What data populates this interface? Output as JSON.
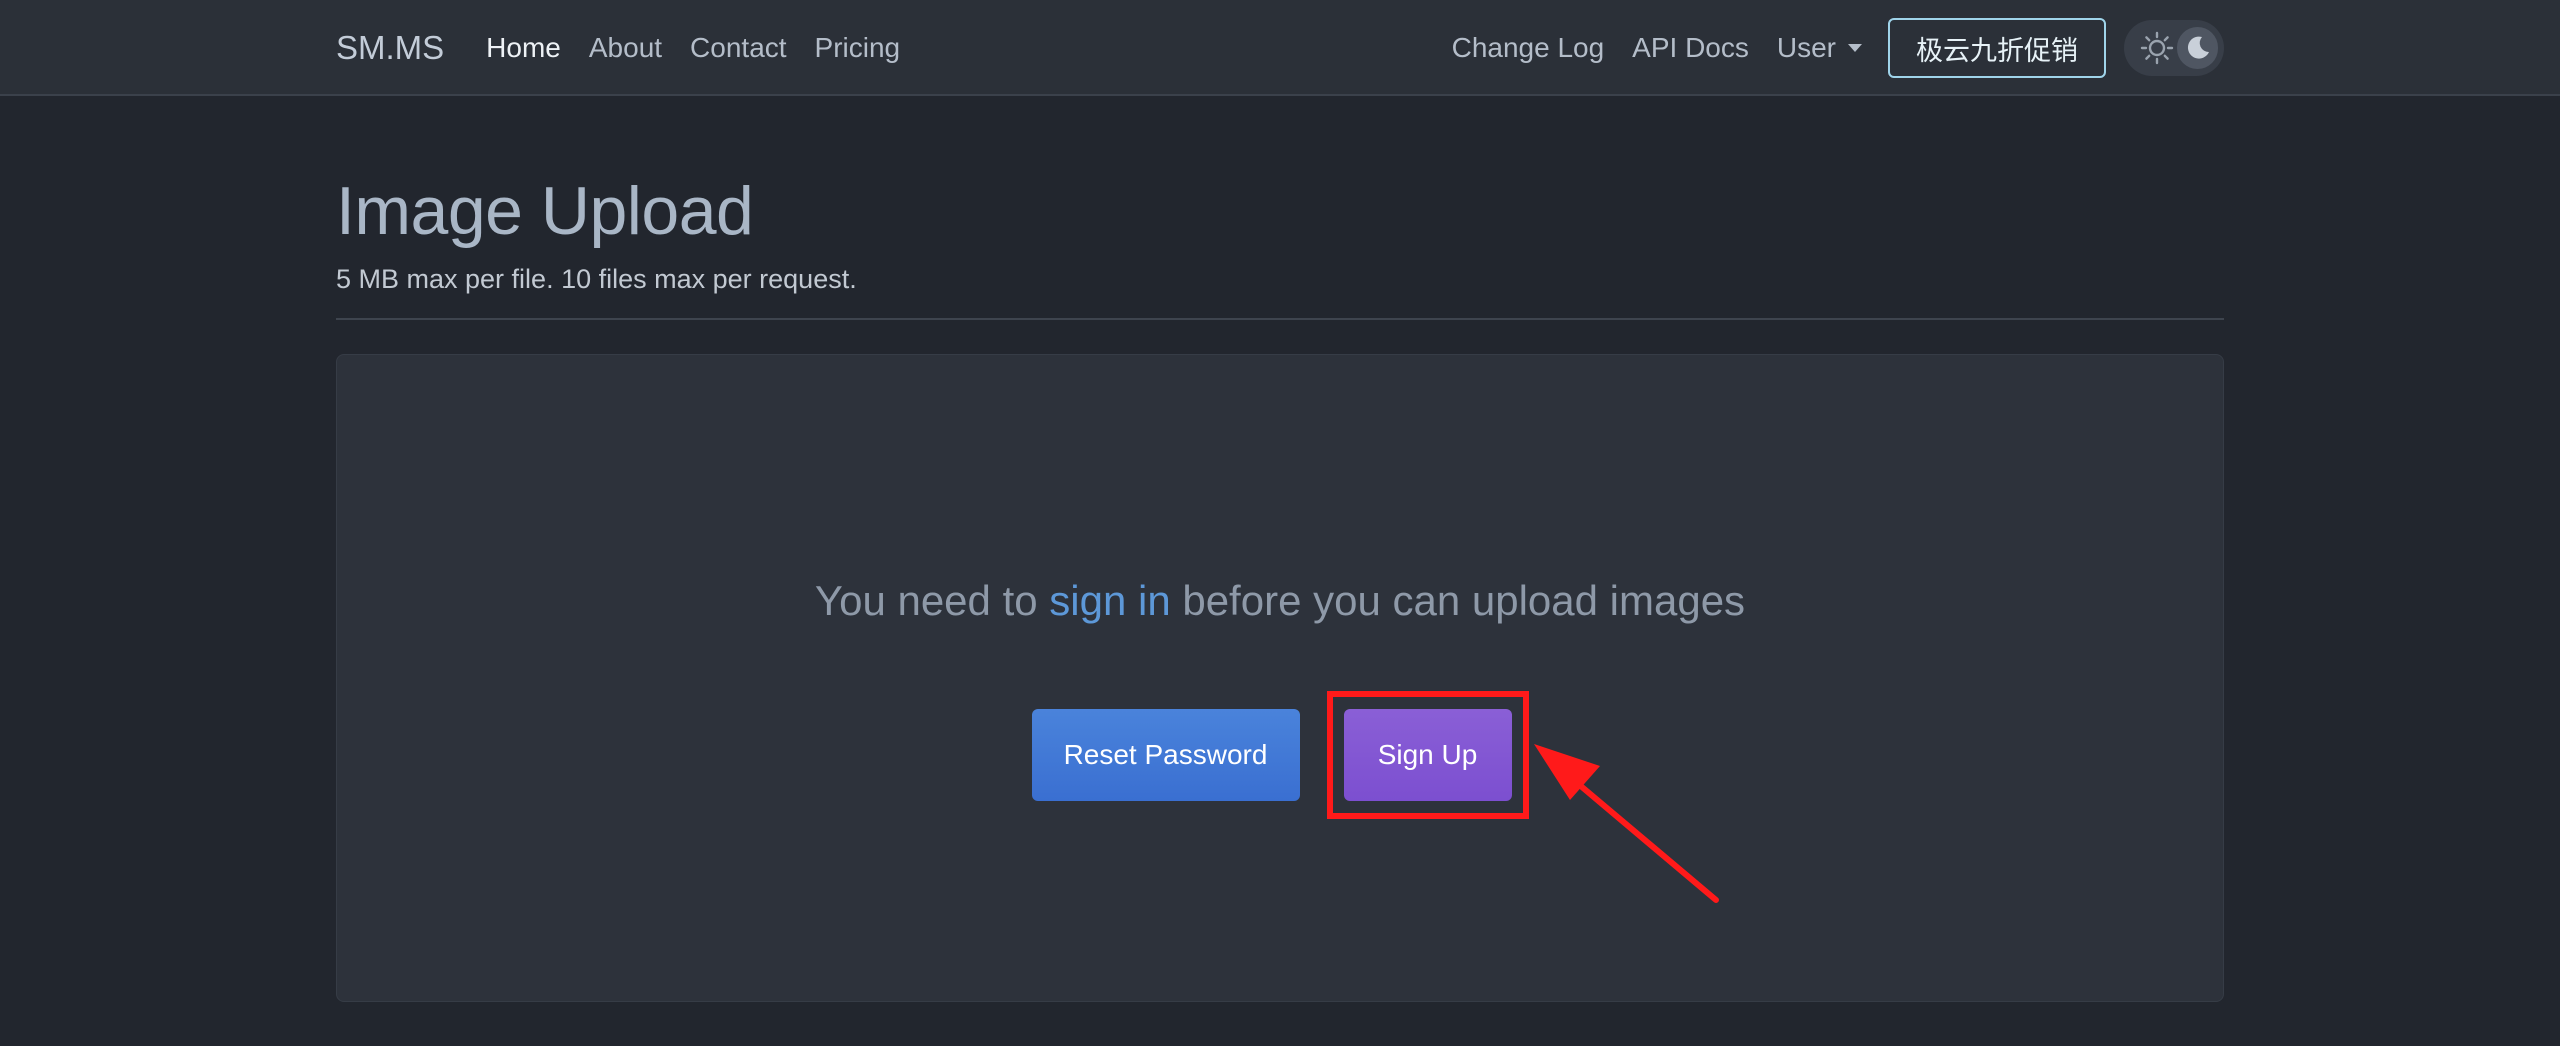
{
  "nav": {
    "brand": "SM.MS",
    "links": [
      "Home",
      "About",
      "Contact",
      "Pricing"
    ],
    "active": "Home",
    "right": {
      "change_log": "Change Log",
      "api_docs": "API Docs",
      "user": "User",
      "promo": "极云九折促销"
    },
    "theme_icons": [
      "sun-icon",
      "moon-icon"
    ]
  },
  "header": {
    "title": "Image Upload",
    "subtitle": "5 MB max per file. 10 files max per request."
  },
  "card": {
    "notice_prefix": "You need to ",
    "notice_link": "sign in",
    "notice_suffix": " before you can upload images",
    "reset_label": "Reset Password",
    "signup_label": "Sign Up"
  },
  "colors": {
    "background": "#22262e",
    "navbar": "#2b3038",
    "card": "#2d323b",
    "link": "#5d98d8",
    "reset_button": "#3f77d6",
    "signup_button": "#8457d3",
    "highlight": "#ff1a1a"
  }
}
